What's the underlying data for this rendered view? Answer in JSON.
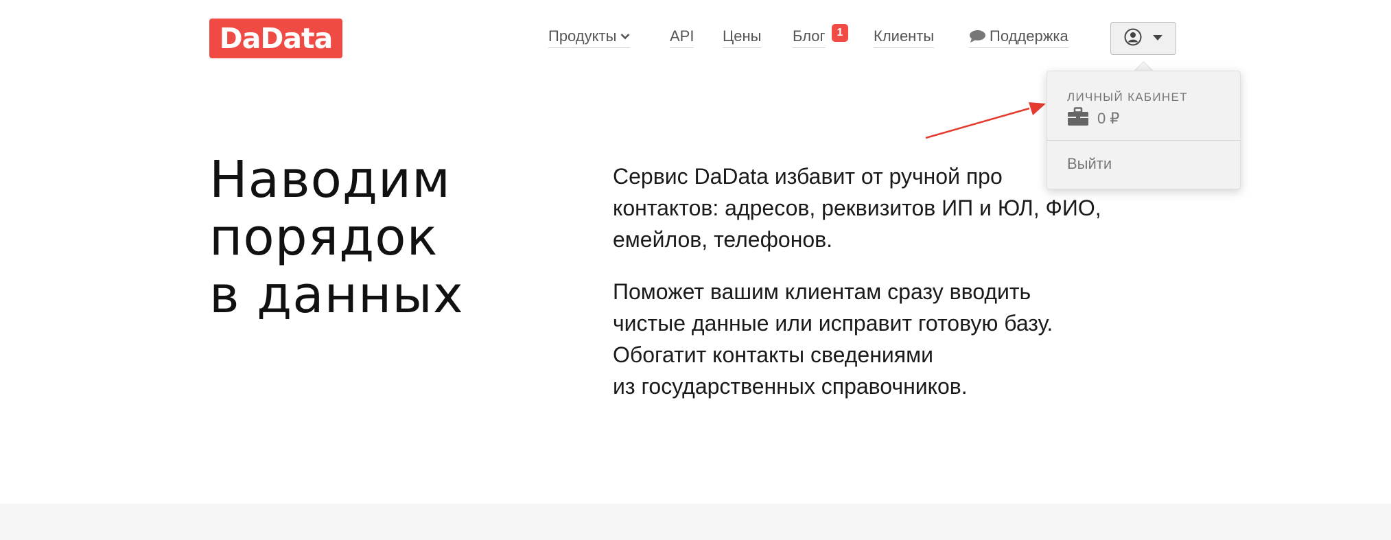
{
  "logo": {
    "text": "DaData"
  },
  "nav": {
    "items": [
      {
        "label": "Продукты",
        "has_chevron": true
      },
      {
        "label": "API"
      },
      {
        "label": "Цены"
      },
      {
        "label": "Блог",
        "badge": "1"
      },
      {
        "label": "Клиенты"
      },
      {
        "label": "Поддержка",
        "icon": "chat-bubble-icon"
      }
    ]
  },
  "account": {
    "icon": "user-circle-icon",
    "dropdown_icon": "caret-down-icon"
  },
  "dropdown": {
    "heading": "ЛИЧНЫЙ КАБИНЕТ",
    "balance": "0 ₽",
    "balance_icon": "briefcase-icon",
    "logout": "Выйти"
  },
  "hero": {
    "title_lines": [
      "Наводим",
      "порядок",
      "в данных"
    ],
    "paragraph1_lines": [
      "Сервис DaData избавит от ручной про",
      "контактов: адресов, реквизитов ИП и ЮЛ, ФИО,",
      "емейлов, телефонов."
    ],
    "paragraph2_lines": [
      "Поможет вашим клиентам сразу вводить",
      "чистые данные или исправит готовую базу.",
      "Обогатит контакты сведениями",
      "из государственных справочников."
    ]
  },
  "colors": {
    "brand": "#ef4b44",
    "annotation_arrow": "#e53b2f",
    "nav_text": "#555555",
    "footer_band": "#f5f5f5"
  }
}
